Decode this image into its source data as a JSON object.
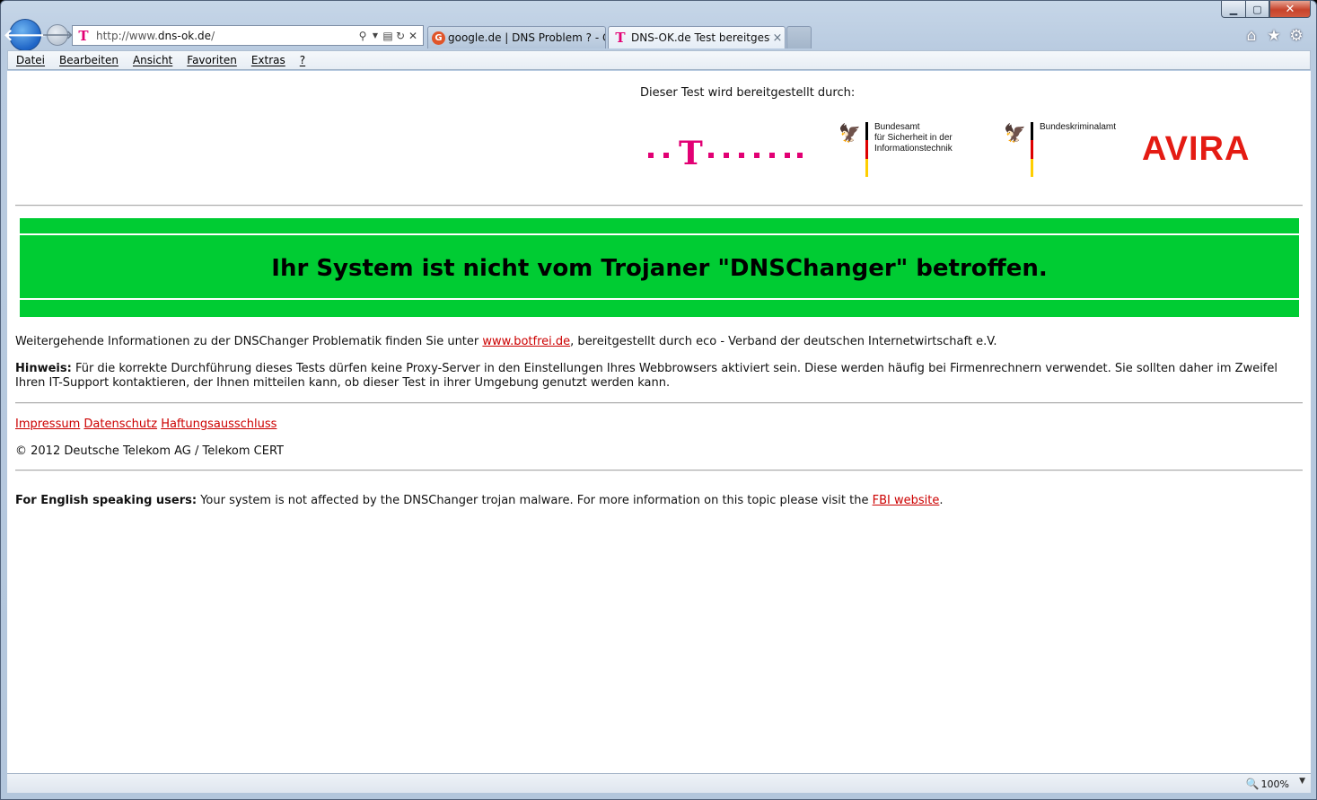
{
  "browser": {
    "address": {
      "prefix": "http://www.",
      "host": "dns-ok.de",
      "suffix": "/"
    },
    "tabs": [
      {
        "label": "google.de | DNS Problem ? - C..."
      },
      {
        "label": "DNS-OK.de Test bereitgeste...",
        "close": "×"
      }
    ],
    "menu": [
      "Datei",
      "Bearbeiten",
      "Ansicht",
      "Favoriten",
      "Extras",
      "?"
    ],
    "window_controls": {
      "minimize": "▁",
      "maximize": "▢",
      "close": "✕"
    },
    "zoom": "100%"
  },
  "page": {
    "sponsor_label": "Dieser Test wird bereitgestellt durch:",
    "logos": {
      "telekom_letter": "T",
      "bsi_text": [
        "Bundesamt",
        "für Sicherheit in der",
        "Informationstechnik"
      ],
      "bka_text": "Bundeskriminalamt",
      "avira": "AVIRA",
      "flag_colors": [
        "#000000",
        "#dd0000",
        "#ffce00"
      ],
      "telekom_color": "#e20074",
      "avira_color": "#e41b13"
    },
    "status_banner": {
      "text": "Ihr System ist nicht vom Trojaner \"DNSChanger\" betroffen.",
      "color": "#00cc33"
    },
    "info_line": {
      "before": "Weitergehende Informationen zu der DNSChanger Problematik finden Sie unter ",
      "link": "www.botfrei.de",
      "after": ", bereitgestellt durch eco - Verband der deutschen Internetwirtschaft e.V."
    },
    "hint": {
      "label": "Hinweis:",
      "text": " Für die korrekte Durchführung dieses Tests dürfen keine Proxy-Server in den Einstellungen Ihres Webbrowsers aktiviert sein. Diese werden häufig bei Firmenrechnern verwendet. Sie sollten daher im Zweifel Ihren IT-Support kontaktieren, der Ihnen mitteilen kann, ob dieser Test in ihrer Umgebung genutzt werden kann."
    },
    "footer_links": [
      "Impressum",
      "Datenschutz",
      "Haftungsausschluss"
    ],
    "copyright": "© 2012 Deutsche Telekom AG / Telekom CERT",
    "english": {
      "label": "For English speaking users:",
      "text": " Your system is not affected by the DNSChanger trojan malware. For more information on this topic please visit the ",
      "link": "FBI website",
      "end": "."
    },
    "link_color": "#cc0000"
  }
}
